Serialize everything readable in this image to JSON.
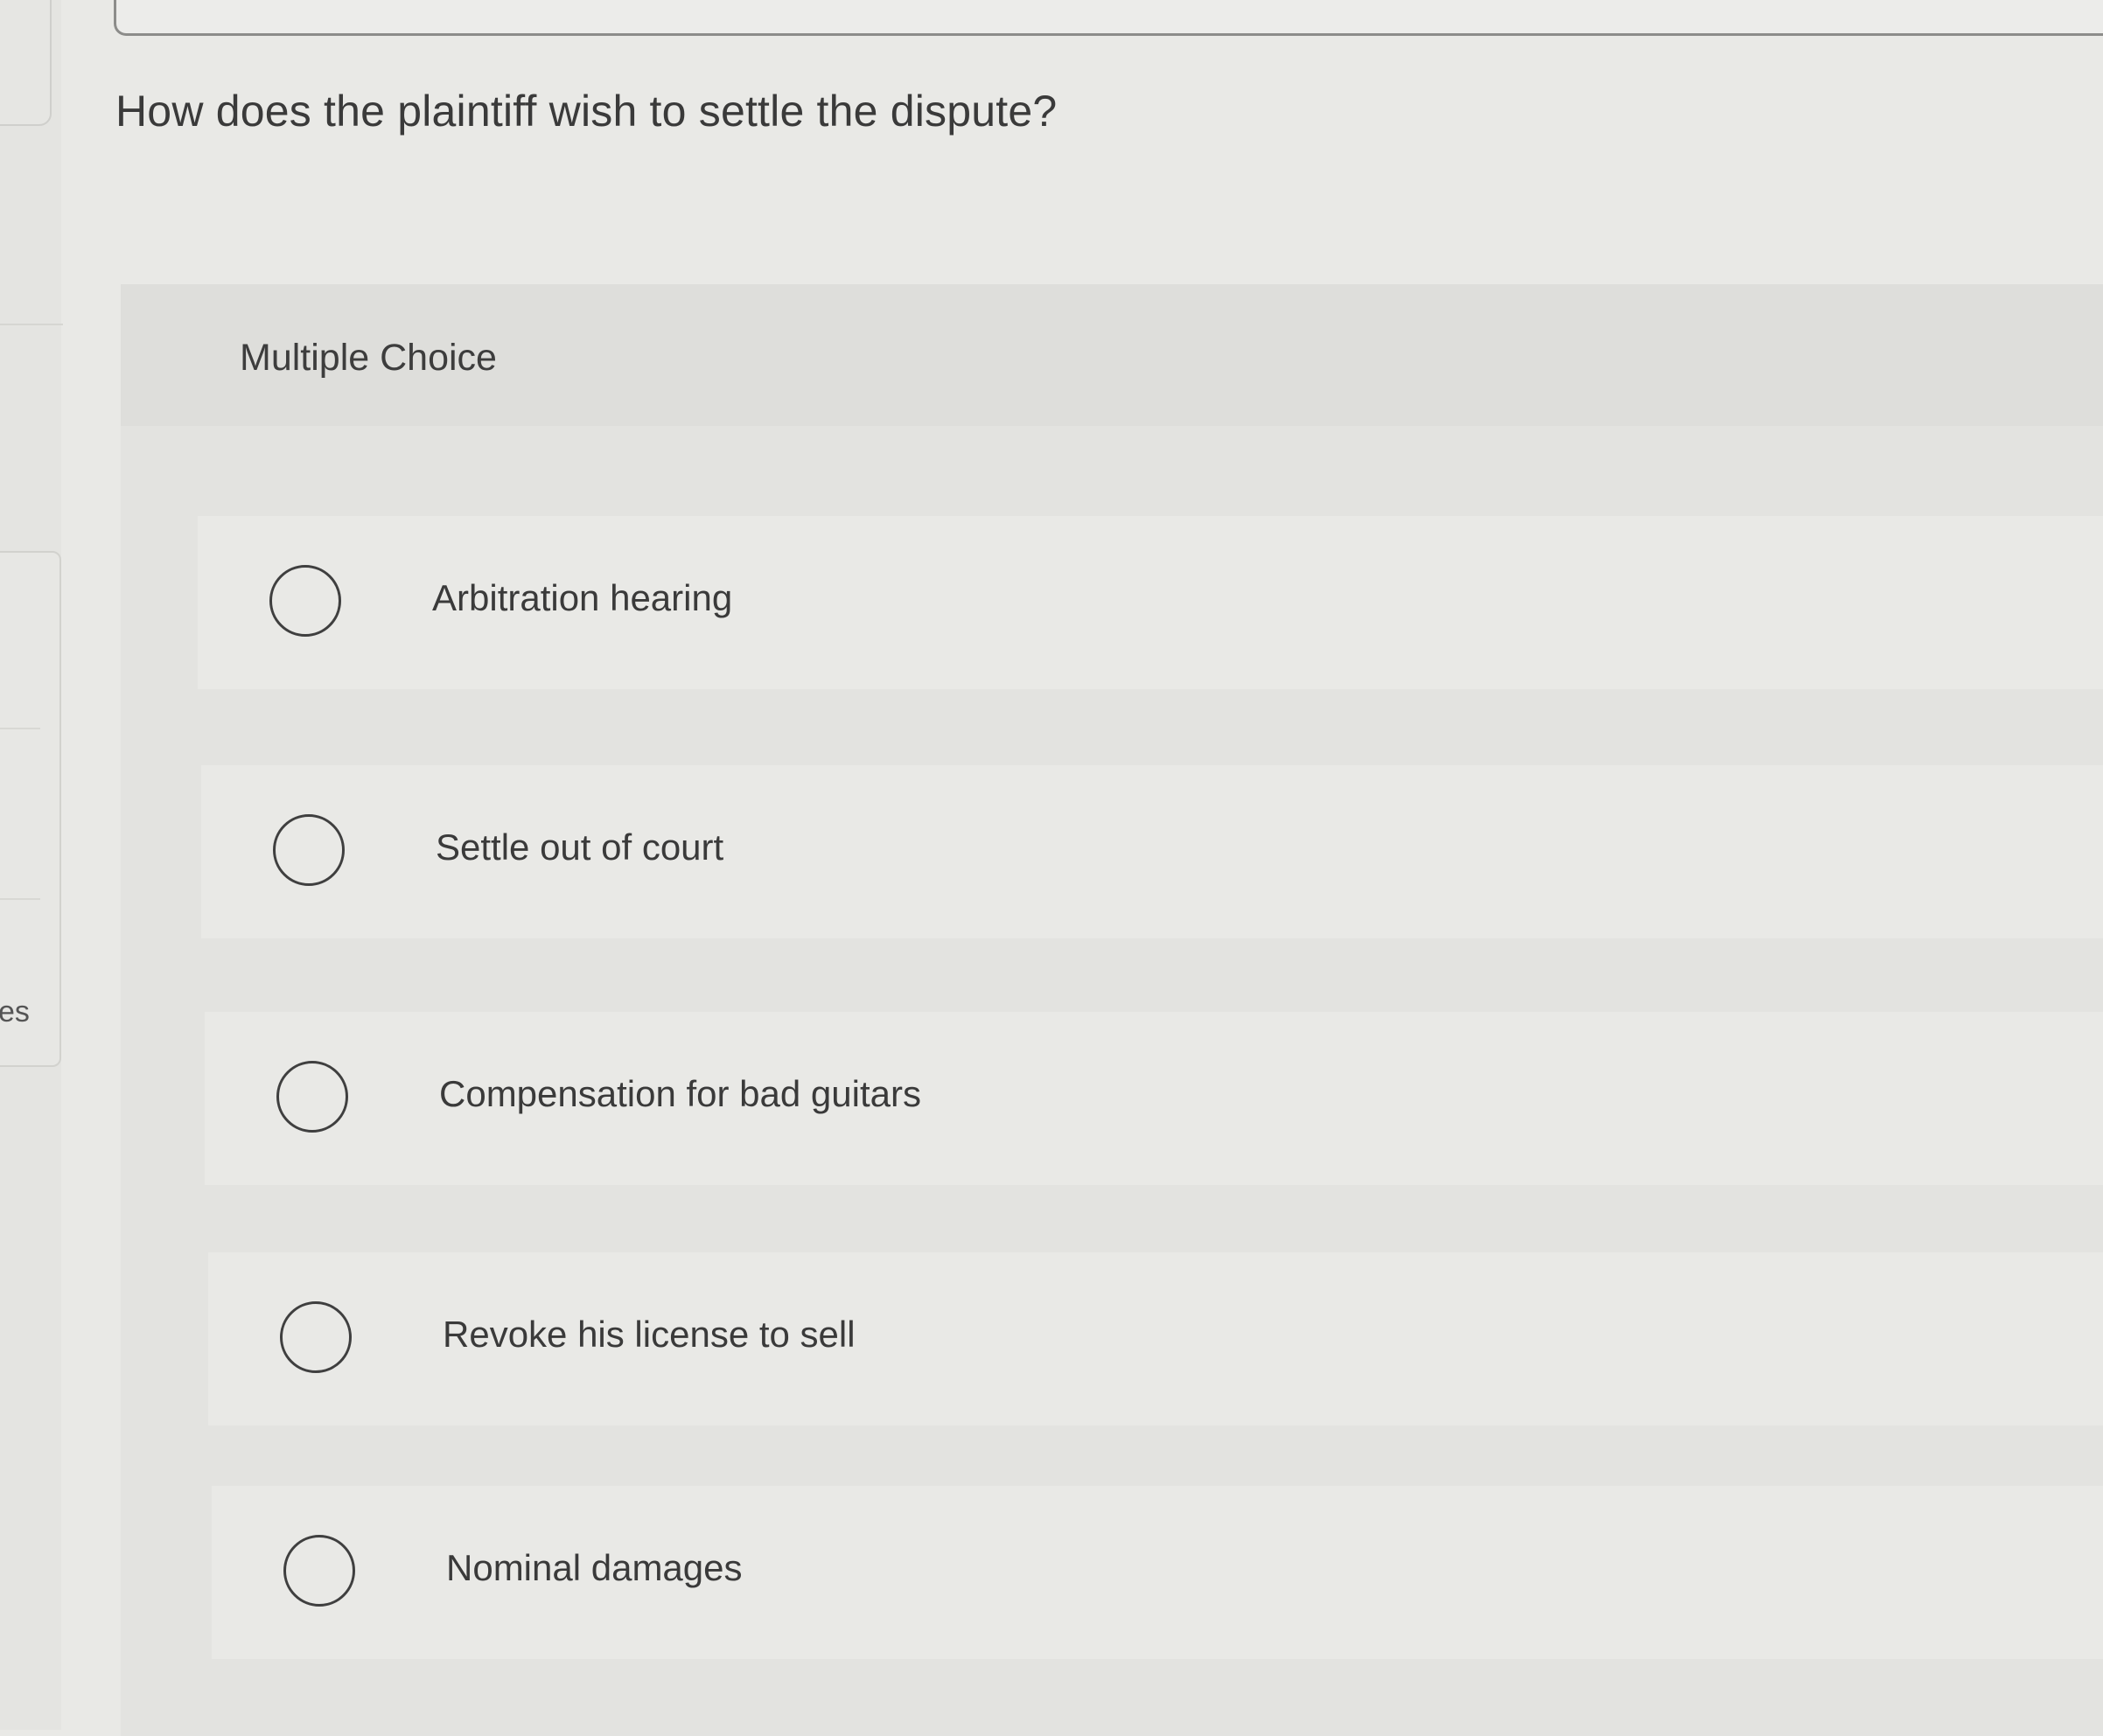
{
  "sidebar": {
    "partial_label": "es"
  },
  "question": {
    "text": "How does the plaintiff wish to settle the dispute?"
  },
  "panel": {
    "type_label": "Multiple Choice"
  },
  "options": [
    {
      "label": "Arbitration hearing",
      "selected": false
    },
    {
      "label": "Settle out of court",
      "selected": false
    },
    {
      "label": "Compensation for bad guitars",
      "selected": false
    },
    {
      "label": "Revoke his license to sell",
      "selected": false
    },
    {
      "label": "Nominal damages",
      "selected": false
    }
  ]
}
